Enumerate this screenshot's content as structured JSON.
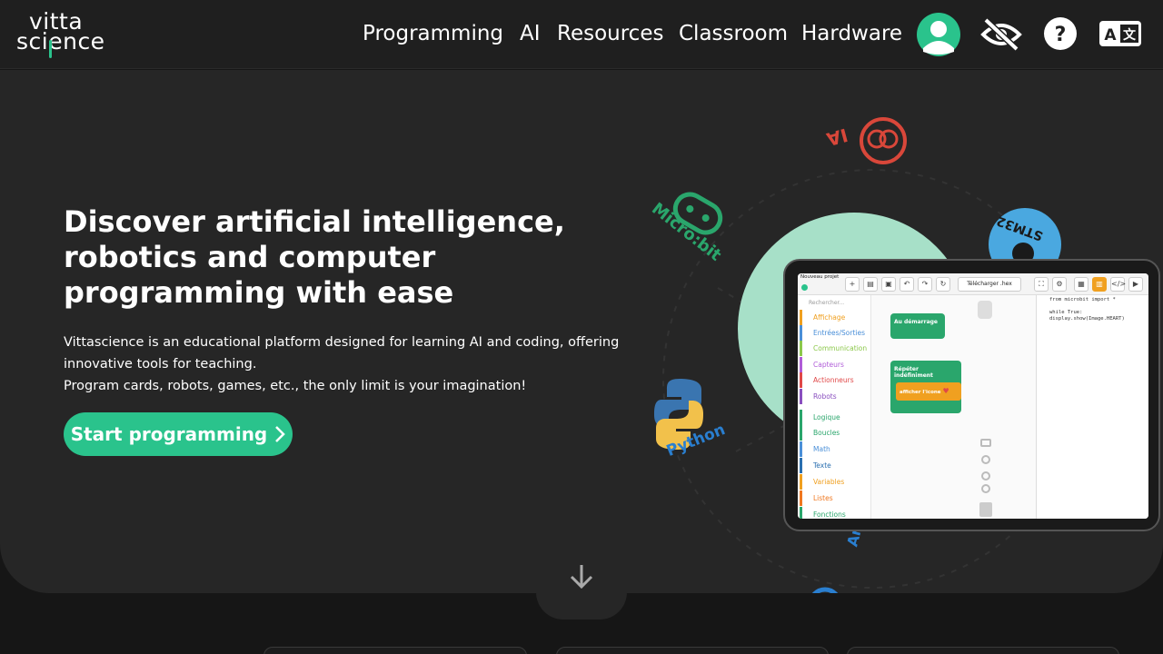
{
  "logo": {
    "line1": "vitta",
    "line2": "science"
  },
  "nav": {
    "items": [
      "Programming",
      "AI",
      "Resources",
      "Classroom",
      "Hardware"
    ],
    "icons": [
      "user-avatar-icon",
      "eye-off-icon",
      "help-icon",
      "translate-icon"
    ]
  },
  "hero": {
    "title": "Discover artificial intelligence, robotics and computer programming with ease",
    "desc1": "Vittascience is an educational platform designed for learning AI and coding, offering innovative tools for teaching.",
    "desc2": "Program cards, robots, games, etc., the only limit is your imagination!",
    "cta": "Start programming",
    "cta_icon": "chevron-right-icon"
  },
  "orbit": {
    "labels": [
      "IA",
      "Micro:bit",
      "STM32",
      "Python",
      "Ar"
    ]
  },
  "editor": {
    "project": "Nouveau projet",
    "download": "Télécharger .hex",
    "search": "Rechercher...",
    "categories": [
      {
        "label": "Affichage",
        "color": "#f0a020"
      },
      {
        "label": "Entrées/Sorties",
        "color": "#4a8fd8"
      },
      {
        "label": "Communication",
        "color": "#8cc84b"
      },
      {
        "label": "Capteurs",
        "color": "#b05cd8"
      },
      {
        "label": "Actionneurs",
        "color": "#e04848"
      },
      {
        "label": "Robots",
        "color": "#8a4fbf"
      },
      {
        "label": "Logique",
        "color": "#2aa66c"
      },
      {
        "label": "Boucles",
        "color": "#2aa66c"
      },
      {
        "label": "Math",
        "color": "#4a8fd8"
      },
      {
        "label": "Texte",
        "color": "#2a6fb0"
      },
      {
        "label": "Variables",
        "color": "#f0a020"
      },
      {
        "label": "Listes",
        "color": "#f07820"
      },
      {
        "label": "Fonctions",
        "color": "#2aa66c"
      }
    ],
    "block_start": "Au démarrage",
    "block_loop": "Répéter indéfiniment",
    "block_show": "afficher l'icone",
    "code_lines": [
      "from microbit import *",
      "",
      "while True:",
      "  display.show(Image.HEART)",
      ""
    ]
  },
  "colors": {
    "accent": "#2ac38c",
    "bg": "#262626",
    "header": "#1f1f1f"
  }
}
